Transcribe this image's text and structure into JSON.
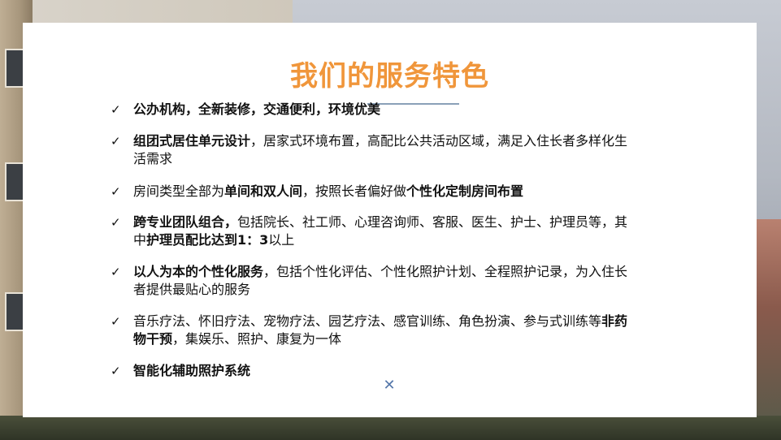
{
  "slide": {
    "title": "我们的服务特色",
    "items": [
      {
        "segments": [
          {
            "text": "公办机构，全新装修，交通便利，环境优美",
            "bold": true
          }
        ]
      },
      {
        "segments": [
          {
            "text": "组团式居住单元设计",
            "bold": true
          },
          {
            "text": "，居家式环境布置，高配比公共活动区域，满足入住长者多样化生",
            "bold": false
          },
          {
            "text": "活需求",
            "bold": false
          }
        ]
      },
      {
        "segments": [
          {
            "text": "房间类型全部为",
            "bold": false
          },
          {
            "text": "单间和双人间",
            "bold": true
          },
          {
            "text": "，按照长者偏好做",
            "bold": false
          },
          {
            "text": "个性化定制房间布置",
            "bold": true
          }
        ]
      },
      {
        "segments": [
          {
            "text": "跨专业团队组合，",
            "bold": true
          },
          {
            "text": "包括院长、社工师、心理咨询师、客服、医生、护士、护理员等，其",
            "bold": false
          },
          {
            "text": "中",
            "bold": false
          },
          {
            "text": "护理员配比达到1：3",
            "bold": true
          },
          {
            "text": "以上",
            "bold": false
          }
        ]
      },
      {
        "segments": [
          {
            "text": "以人为本的个性化服务",
            "bold": true
          },
          {
            "text": "，包括个性化评估、个性化照护计划、全程照护记录，为入住长",
            "bold": false
          },
          {
            "text": "者提供最贴心的服务",
            "bold": false
          }
        ]
      },
      {
        "segments": [
          {
            "text": "音乐疗法、怀旧疗法、宠物疗法、园艺疗法、感官训练、角色扮演、参与式训练等",
            "bold": false
          },
          {
            "text": "非药",
            "bold": true
          },
          {
            "text": "物干预",
            "bold": true
          },
          {
            "text": "，集娱乐、照护、康复为一体",
            "bold": false
          }
        ]
      },
      {
        "segments": [
          {
            "text": "智能化辅助照护系统",
            "bold": true
          }
        ]
      }
    ],
    "check_glyph": "✓",
    "close_glyph": "✕",
    "icons": {
      "bullet": "checkmark-icon",
      "bottom": "close-icon"
    },
    "colors": {
      "title": "#f0963b",
      "rule": "#8aa0b8",
      "close": "#5577aa"
    }
  }
}
